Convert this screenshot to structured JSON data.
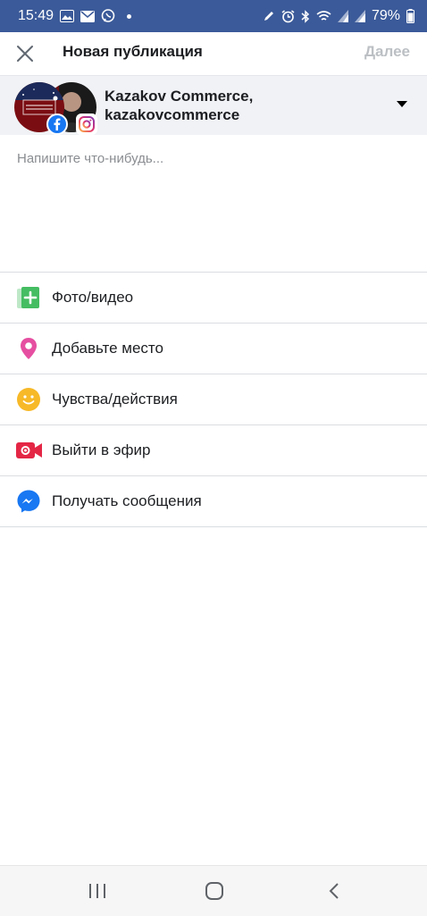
{
  "status_bar": {
    "time": "15:49",
    "battery": "79%",
    "left_icons": [
      "gallery-icon",
      "mail-icon",
      "viber-icon"
    ],
    "right_icons": [
      "pen-icon",
      "alarm-icon",
      "bluetooth-icon",
      "wifi-icon",
      "signal-icon",
      "signal-icon",
      "battery-icon"
    ]
  },
  "header": {
    "title": "Новая публикация",
    "next_label": "Далее"
  },
  "account": {
    "line1": "Kazakov Commerce,",
    "line2": "kazakovcommerce"
  },
  "composer": {
    "placeholder": "Напишите что-нибудь..."
  },
  "options": [
    {
      "label": "Фото/видео",
      "icon": "photo-video-icon",
      "color": "#45bd62"
    },
    {
      "label": "Добавьте место",
      "icon": "location-pin-icon",
      "color": "#e64fa1"
    },
    {
      "label": "Чувства/действия",
      "icon": "smiley-icon",
      "color": "#f7b928"
    },
    {
      "label": "Выйти в эфир",
      "icon": "live-video-icon",
      "color": "#e42645"
    },
    {
      "label": "Получать сообщения",
      "icon": "messenger-icon",
      "color": "#1877f2"
    }
  ],
  "colors": {
    "status_bar": "#3b5a99",
    "account_bg": "#f0f2f5",
    "disabled_text": "#bcc0c4"
  }
}
